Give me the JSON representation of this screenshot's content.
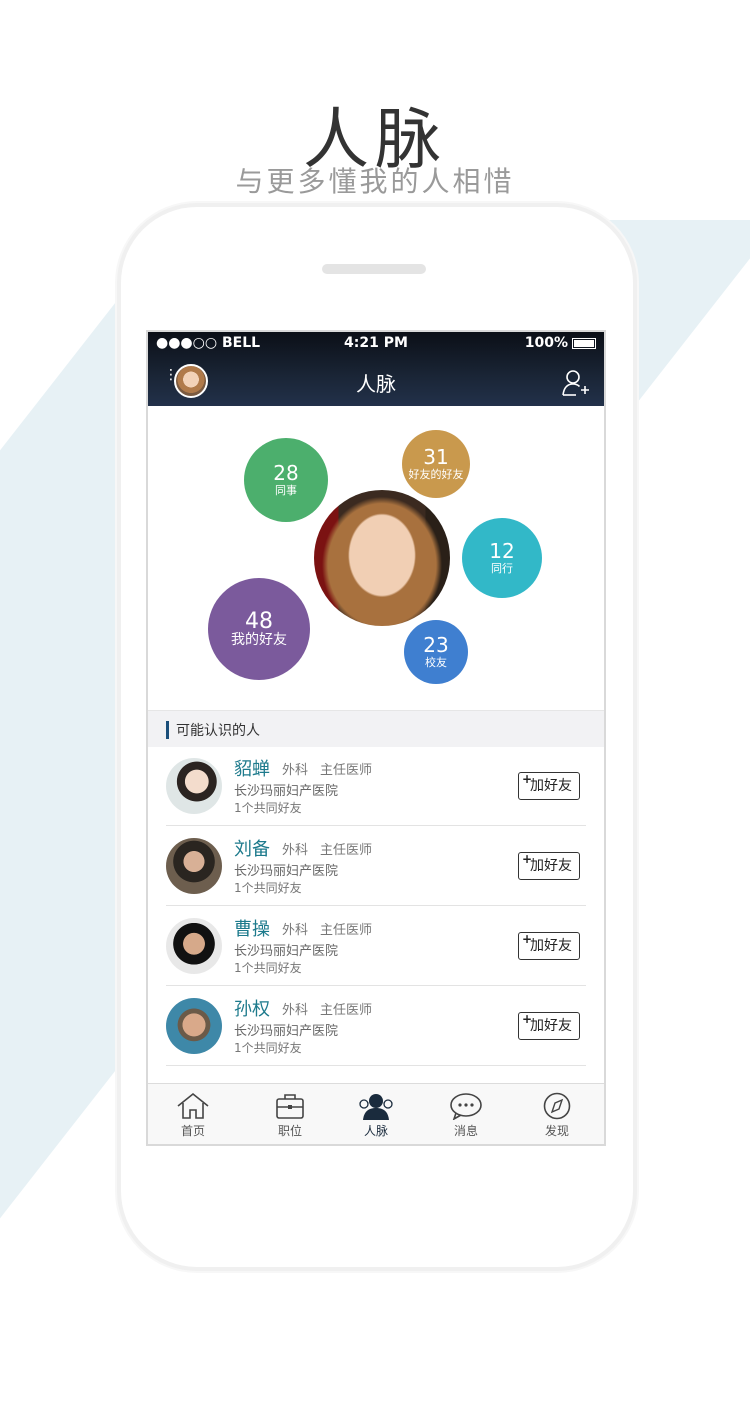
{
  "hero": {
    "title": "人脉",
    "subtitle": "与更多懂我的人相惜"
  },
  "status_bar": {
    "carrier": "●●●○○ BELL",
    "time": "4:21 PM",
    "battery": "100%"
  },
  "nav": {
    "title": "人脉"
  },
  "bubbles": {
    "colleagues": {
      "count": "28",
      "label": "同事",
      "color": "#4caf6d"
    },
    "friends_of_friends": {
      "count": "31",
      "label": "好友的好友",
      "color": "#c9994d"
    },
    "peers": {
      "count": "12",
      "label": "同行",
      "color": "#32b8c8"
    },
    "my_friends": {
      "count": "48",
      "label": "我的好友",
      "color": "#7b5a9c"
    },
    "alumni": {
      "count": "23",
      "label": "校友",
      "color": "#3f7fd0"
    }
  },
  "section": {
    "title": "可能认识的人"
  },
  "people": [
    {
      "name": "貂蝉",
      "dept": "外科",
      "title": "主任医师",
      "hospital": "长沙玛丽妇产医院",
      "mutual": "1个共同好友",
      "button": "加好友"
    },
    {
      "name": "刘备",
      "dept": "外科",
      "title": "主任医师",
      "hospital": "长沙玛丽妇产医院",
      "mutual": "1个共同好友",
      "button": "加好友"
    },
    {
      "name": "曹操",
      "dept": "外科",
      "title": "主任医师",
      "hospital": "长沙玛丽妇产医院",
      "mutual": "1个共同好友",
      "button": "加好友"
    },
    {
      "name": "孙权",
      "dept": "外科",
      "title": "主任医师",
      "hospital": "长沙玛丽妇产医院",
      "mutual": "1个共同好友",
      "button": "加好友"
    }
  ],
  "tabs": [
    {
      "label": "首页",
      "icon": "home-icon"
    },
    {
      "label": "职位",
      "icon": "briefcase-icon"
    },
    {
      "label": "人脉",
      "icon": "people-icon"
    },
    {
      "label": "消息",
      "icon": "chat-icon"
    },
    {
      "label": "发现",
      "icon": "compass-icon"
    }
  ]
}
